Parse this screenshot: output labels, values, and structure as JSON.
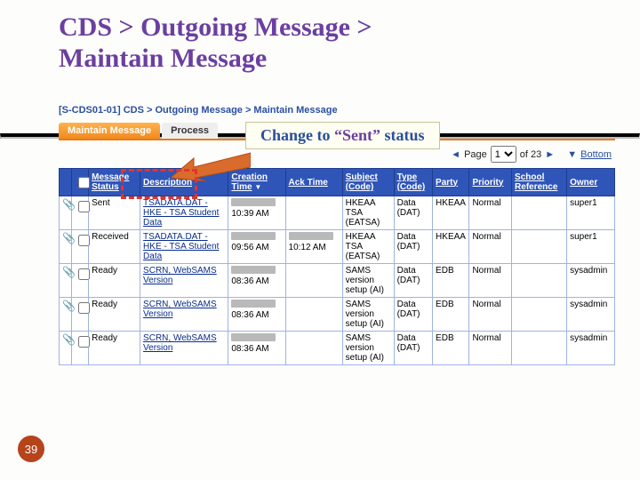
{
  "slide": {
    "title_line1": "CDS > Outgoing Message >",
    "title_line2": "Maintain Message",
    "page_number": "39"
  },
  "callout": {
    "prefix": "Change to ",
    "quoted": "“Sent”",
    "suffix": " status"
  },
  "breadcrumb": "[S-CDS01-01] CDS > Outgoing Message > Maintain Message",
  "tabs": {
    "maintain": "Maintain Message",
    "process": "Process"
  },
  "pager": {
    "page_prefix": "Page ",
    "page_value": "1",
    "of_text": " of 23 ",
    "bottom_symbol": "▼",
    "bottom_text": "Bottom"
  },
  "headers": {
    "clip": "",
    "chk": "",
    "status": "Message Status",
    "desc": "Description",
    "ctime": "Creation Time",
    "atime": "Ack Time",
    "subject": "Subject (Code)",
    "type": "Type (Code)",
    "party": "Party",
    "priority": "Priority",
    "schoolref": "School Reference",
    "owner": "Owner"
  },
  "rows": [
    {
      "status": "Sent",
      "desc": "TSADATA.DAT - HKE - TSA Student Data",
      "ctime2": "10:39 AM",
      "atime2": "",
      "subject": "HKEAA TSA (EATSA)",
      "type": "Data (DAT)",
      "party": "HKEAA",
      "priority": "Normal",
      "owner": "super1"
    },
    {
      "status": "Received",
      "desc": "TSADATA.DAT - HKE - TSA Student Data",
      "ctime2": "09:56 AM",
      "atime2": "10:12 AM",
      "subject": "HKEAA TSA (EATSA)",
      "type": "Data (DAT)",
      "party": "HKEAA",
      "priority": "Normal",
      "owner": "super1"
    },
    {
      "status": "Ready",
      "desc": "SCRN, WebSAMS Version",
      "ctime2": "08:36 AM",
      "atime2": "",
      "subject": "SAMS version setup (AI)",
      "type": "Data (DAT)",
      "party": "EDB",
      "priority": "Normal",
      "owner": "sysadmin"
    },
    {
      "status": "Ready",
      "desc": "SCRN, WebSAMS Version",
      "ctime2": "08:36 AM",
      "atime2": "",
      "subject": "SAMS version setup (AI)",
      "type": "Data (DAT)",
      "party": "EDB",
      "priority": "Normal",
      "owner": "sysadmin"
    },
    {
      "status": "Ready",
      "desc": "SCRN, WebSAMS Version",
      "ctime2": "08:36 AM",
      "atime2": "",
      "subject": "SAMS version setup (AI)",
      "type": "Data (DAT)",
      "party": "EDB",
      "priority": "Normal",
      "owner": "sysadmin"
    }
  ]
}
